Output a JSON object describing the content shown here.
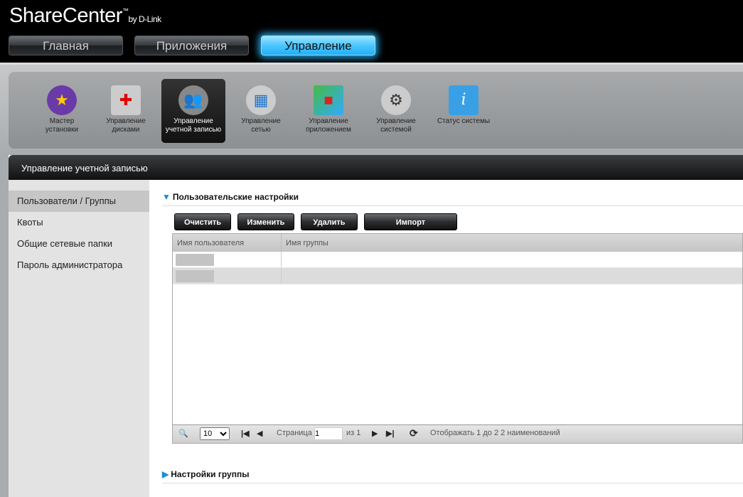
{
  "header": {
    "logo": "ShareCenter",
    "logo_tm": "™",
    "logo_by": "by D-Link",
    "nav": [
      "Главная",
      "Приложения",
      "Управление"
    ]
  },
  "tools": [
    {
      "line1": "Мастер",
      "line2": "установки",
      "icon": "wizard-icon"
    },
    {
      "line1": "Управление",
      "line2": "дисками",
      "icon": "disk-icon"
    },
    {
      "line1": "Управление",
      "line2": "учетной записью",
      "icon": "users-icon"
    },
    {
      "line1": "Управление",
      "line2": "сетью",
      "icon": "network-icon"
    },
    {
      "line1": "Управление",
      "line2": "приложением",
      "icon": "apps-icon"
    },
    {
      "line1": "Управление",
      "line2": "системой",
      "icon": "system-icon"
    },
    {
      "line1": "Статус системы",
      "line2": "",
      "icon": "info-icon"
    }
  ],
  "panel_title": "Управление учетной записью",
  "sidebar": [
    "Пользователи / Группы",
    "Квоты",
    "Общие сетевые папки",
    "Пароль администратора"
  ],
  "user_section": "Пользовательские настройки",
  "group_section": "Настройки группы",
  "buttons": {
    "clear": "Очистить",
    "edit": "Изменить",
    "delete": "Удалить",
    "import": "Импорт"
  },
  "grid": {
    "col_user": "Имя пользователя",
    "col_group": "Имя группы"
  },
  "pager": {
    "page_size": "10",
    "page_label": "Страница",
    "page": "1",
    "of": "из 1",
    "summary": "Отображать 1 до 2 2 наименований"
  }
}
